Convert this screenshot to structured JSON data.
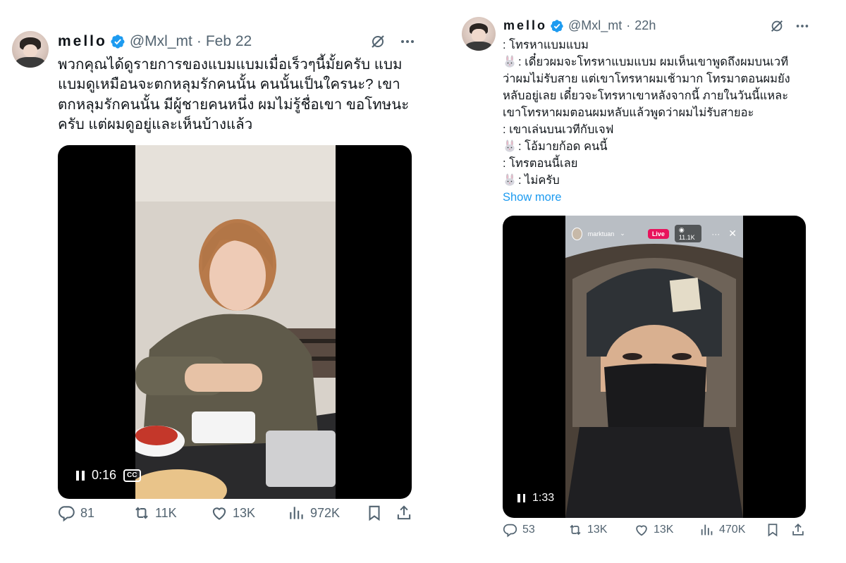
{
  "tweets": [
    {
      "name": "mello",
      "handle": "@Mxl_mt",
      "date": "Feb 22",
      "text_lines": [
        "พวกคุณได้ดูรายการของแบมแบมเมื่อเร็วๆนี้มั้ยครับ แบม",
        "แบมดูเหมือนจะตกหลุมรักคนนั้น คนนั้นเป็นใครนะ? เขา",
        "ตกหลุมรักคนนั้น มีผู้ชายคนหนึ่ง ผมไม่รู้ชื่อเขา ขอโทษนะ",
        "ครับ แต่ผมดูอยู่และเห็นบ้างแล้ว"
      ],
      "video_time": "0:16",
      "cc_label": "CC",
      "stats": {
        "replies": "81",
        "reposts": "11K",
        "likes": "13K",
        "views": "972K"
      }
    },
    {
      "name": "mello",
      "handle": "@Mxl_mt",
      "date": "22h",
      "text_lines": [
        ": โทรหาแบมแบม",
        ": เดี๋ยวผมจะโทรหาแบมแบม ผมเห็นเขาพูดถึงผมบนเวที",
        "ว่าผมไม่รับสาย แต่เขาโทรหาผมเช้ามาก โทรมาตอนผมยัง",
        "หลับอยู่เลย เดี๋ยวจะโทรหาเขาหลังจากนี้ ภายในวันนี้แหละ",
        "เขาโทรหาผมตอนผมหลับแล้วพูดว่าผมไม่รับสายอะ",
        ": เขาเล่นบนเวทีกับเจฟ",
        ": โอ้มายก้อด คนนี้",
        ": โทรตอนนี้เลย",
        ": ไม่ครับ"
      ],
      "show_more": "Show more",
      "live": {
        "username": "marktuan",
        "live_label": "Live",
        "viewers": "11.1K"
      },
      "video_time": "1:33",
      "stats": {
        "replies": "53",
        "reposts": "13K",
        "likes": "13K",
        "views": "470K"
      }
    }
  ],
  "icons": {
    "verified": "verified-badge-icon",
    "grok": "grok-icon",
    "more": "more-icon",
    "reply": "reply-icon",
    "repost": "repost-icon",
    "like": "like-icon",
    "views": "views-icon",
    "bookmark": "bookmark-icon",
    "share": "share-icon",
    "rabbit": "rabbit-emoji-icon"
  },
  "colors": {
    "accent": "#1d9bf0",
    "secondary_text": "#536471",
    "live": "#e8135c"
  }
}
